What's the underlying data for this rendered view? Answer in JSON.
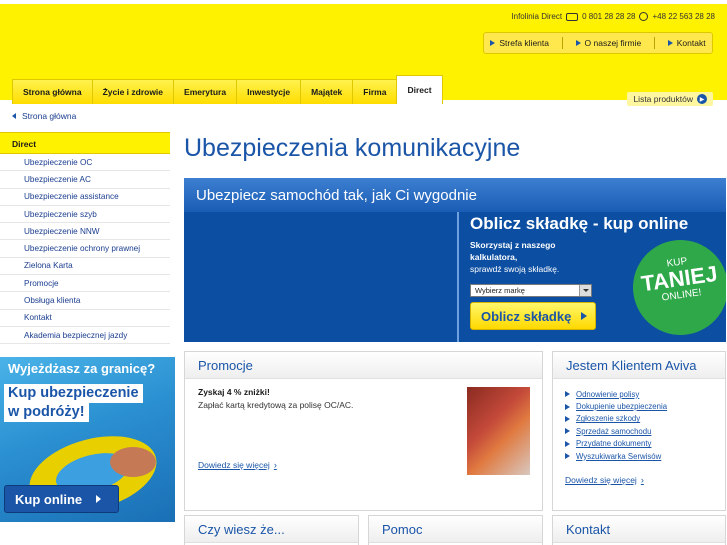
{
  "header": {
    "infolinia_label": "Infolinia Direct",
    "phone": "0 801 28 28 28",
    "phone2": "+48 22 563 28 28",
    "top_links": [
      "Strefa klienta",
      "O naszej firmie",
      "Kontakt"
    ],
    "tabs": [
      "Strona główna",
      "Życie i zdrowie",
      "Emerytura",
      "Inwestycje",
      "Majątek",
      "Firma",
      "Direct"
    ],
    "active_tab": "Direct",
    "lista_produktow": "Lista produktów"
  },
  "sidebar": {
    "back_label": "Strona główna",
    "section_title": "Direct",
    "items": [
      "Ubezpieczenie OC",
      "Ubezpieczenie AC",
      "Ubezpieczenie assistance",
      "Ubezpieczenie szyb",
      "Ubezpieczenie NNW",
      "Ubezpieczenie ochrony prawnej",
      "Zielona Karta",
      "Promocje",
      "Obsługa klienta",
      "Kontakt",
      "Akademia bezpiecznej jazdy"
    ]
  },
  "travel_banner": {
    "line1": "Wyjeżdżasz za granicę?",
    "line2": "Kup ubezpieczenie",
    "line3": "w podróży!",
    "button": "Kup online"
  },
  "main": {
    "title": "Ubezpieczenia komunikacyjne",
    "hero": {
      "title": "Ubezpiecz samochód tak, jak Ci wygodnie",
      "calc_title": "Oblicz składkę - kup online",
      "desc_bold": "Skorzystaj z naszego kalkulatora,",
      "desc": "sprawdź swoją składkę.",
      "select_value": "Wybierz markę",
      "button": "Oblicz składkę",
      "badge_top": "KUP",
      "badge_mid": "TANIEJ",
      "badge_bottom": "ONLINE!"
    },
    "promocje": {
      "title": "Promocje",
      "headline": "Zyskaj 4 % zniżki!",
      "text": "Zapłać kartą kredytową za polisę OC/AC.",
      "more": "Dowiedz się więcej"
    },
    "aviva": {
      "title": "Jestem Klientem Aviva",
      "links": [
        "Odnowienie polisy",
        "Dokupienie ubezpieczenia",
        "Zgłoszenie szkody",
        "Sprzedaż samochodu",
        "Przydatne dokumenty",
        "Wyszukiwarka Serwisów"
      ],
      "more": "Dowiedz się więcej"
    },
    "bottom_boxes": [
      "Czy wiesz że...",
      "Pomoc",
      "Kontakt"
    ]
  },
  "colors": {
    "brand_yellow": "#fff200",
    "brand_blue": "#1a55a8",
    "hero_blue": "#0b4ea2",
    "badge_green": "#2fa84a"
  }
}
